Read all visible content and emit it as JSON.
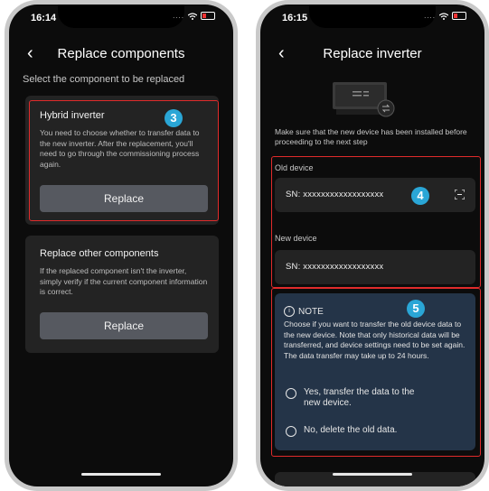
{
  "left": {
    "status": {
      "time": "16:14"
    },
    "header": {
      "title": "Replace components"
    },
    "subtitle": "Select the component to be replaced",
    "card1": {
      "title": "Hybrid inverter",
      "desc": "You need to choose whether to transfer data to the new inverter. After the replacement, you'll need to go through the commissioning process again.",
      "button": "Replace",
      "badge": "3"
    },
    "card2": {
      "title": "Replace other components",
      "desc": "If the replaced component isn't the inverter, simply verify if the current component information is correct.",
      "button": "Replace"
    }
  },
  "right": {
    "status": {
      "time": "16:15"
    },
    "header": {
      "title": "Replace inverter"
    },
    "desc": "Make sure that the new device has been installed before proceeding to the next step",
    "old_label": "Old device",
    "old_sn": "SN: xxxxxxxxxxxxxxxxxx",
    "new_label": "New device",
    "new_sn": "SN: xxxxxxxxxxxxxxxxxx",
    "badge4": "4",
    "badge5": "5",
    "note": {
      "title": "NOTE",
      "text": "Choose if you want to transfer the old device data to the new device. Note that only historical data will be transferred, and device settings need to be set again. The data transfer may take up to 24 hours.",
      "option1": "Yes, transfer the data to the new device.",
      "option2": "No, delete the old data."
    }
  },
  "colors": {
    "accent_badge": "#2aa6d6",
    "highlight": "#e02b2b",
    "note_bg": "#243448"
  },
  "icons": [
    "back-arrow-icon",
    "wifi-icon",
    "battery-icon",
    "scan-icon",
    "info-icon",
    "inverter-illustration-icon"
  ]
}
